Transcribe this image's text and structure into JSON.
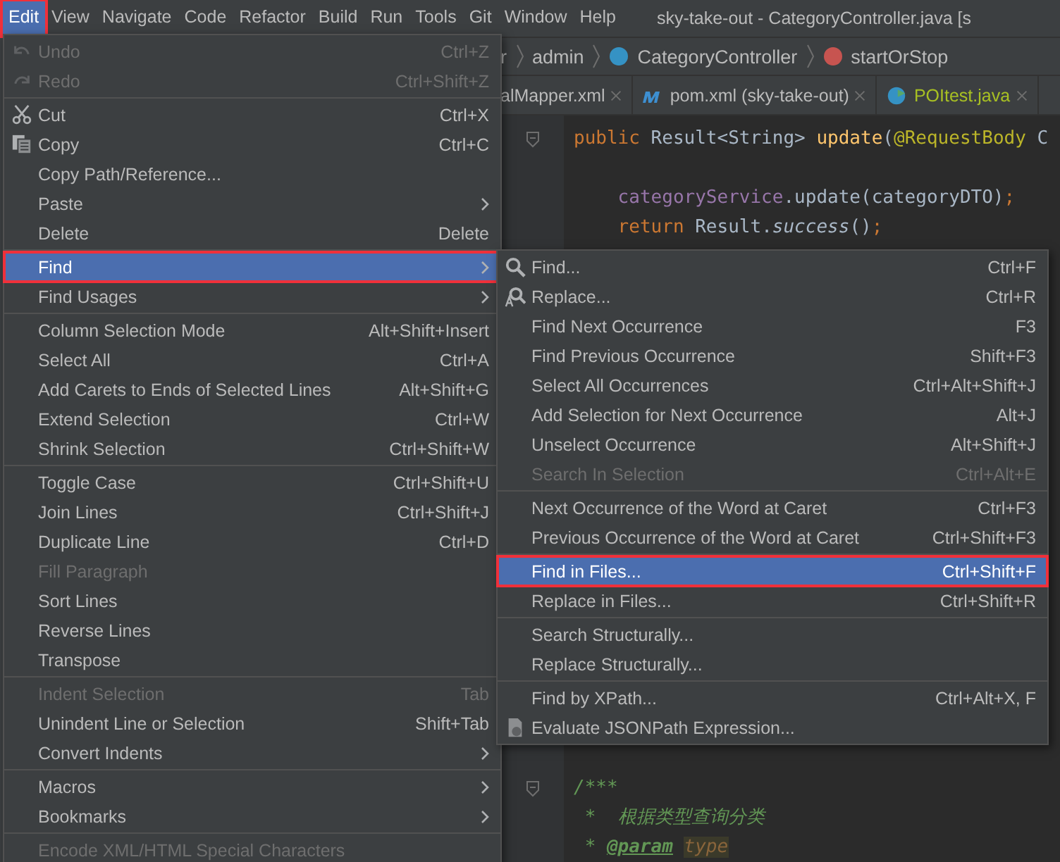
{
  "menu_bar": {
    "items": [
      {
        "label": "Edit",
        "selected": true,
        "highlighted": true
      },
      {
        "label": "View",
        "selected": false,
        "highlighted": false
      },
      {
        "label": "Navigate",
        "selected": false,
        "highlighted": false
      },
      {
        "label": "Code",
        "selected": false,
        "highlighted": false
      },
      {
        "label": "Refactor",
        "selected": false,
        "highlighted": false
      },
      {
        "label": "Build",
        "selected": false,
        "highlighted": false
      },
      {
        "label": "Run",
        "selected": false,
        "highlighted": false
      },
      {
        "label": "Tools",
        "selected": false,
        "highlighted": false
      },
      {
        "label": "Git",
        "selected": false,
        "highlighted": false
      },
      {
        "label": "Window",
        "selected": false,
        "highlighted": false
      },
      {
        "label": "Help",
        "selected": false,
        "highlighted": false
      }
    ],
    "title": "sky-take-out - CategoryController.java [s"
  },
  "breadcrumbs": [
    {
      "label": "r",
      "kind": "text"
    },
    {
      "label": "admin",
      "kind": "text"
    },
    {
      "label": "CategoryController",
      "kind": "class"
    },
    {
      "label": "startOrStop",
      "kind": "method"
    }
  ],
  "tabs": [
    {
      "label": "alMapper.xml",
      "kind": "xml"
    },
    {
      "label": "pom.xml (sky-take-out)",
      "kind": "maven"
    },
    {
      "label": "POItest.java",
      "kind": "test"
    }
  ],
  "code_top": [
    {
      "kind": "code",
      "tokens": [
        {
          "text": "public",
          "kind": "keyword"
        },
        {
          "text": " Result<String> ",
          "kind": "plain"
        },
        {
          "text": "update",
          "kind": "method"
        },
        {
          "text": "(",
          "kind": "plain"
        },
        {
          "text": "@RequestBody",
          "kind": "annotation"
        },
        {
          "text": " C",
          "kind": "plain"
        }
      ]
    },
    {
      "kind": "blank"
    },
    {
      "kind": "code",
      "tokens": [
        {
          "text": "    categoryService",
          "kind": "field"
        },
        {
          "text": ".update(categoryDTO)",
          "kind": "plain"
        },
        {
          "text": ";",
          "kind": "keyword"
        }
      ]
    },
    {
      "kind": "code",
      "tokens": [
        {
          "text": "    return",
          "kind": "keyword"
        },
        {
          "text": " Result.",
          "kind": "plain"
        },
        {
          "text": "success",
          "kind": "static"
        },
        {
          "text": "()",
          "kind": "plain"
        },
        {
          "text": ";",
          "kind": "keyword"
        }
      ]
    }
  ],
  "code_bottom": [
    {
      "kind": "code",
      "tokens": [
        {
          "text": "/***",
          "kind": "comment"
        }
      ]
    },
    {
      "kind": "code",
      "tokens": [
        {
          "text": " *  根据类型查询分类",
          "kind": "comment"
        }
      ]
    },
    {
      "kind": "code",
      "tokens": [
        {
          "text": " * ",
          "kind": "comment"
        },
        {
          "text": "@param",
          "kind": "doctag"
        },
        {
          "text": "type",
          "kind": "docparam"
        }
      ]
    }
  ],
  "edit_menu": {
    "groups": [
      [
        {
          "label": "Undo",
          "shortcut": "Ctrl+Z",
          "kind": "action",
          "disabled": true,
          "selected": false,
          "highlighted": false
        },
        {
          "label": "Redo",
          "shortcut": "Ctrl+Shift+Z",
          "kind": "action",
          "disabled": true,
          "selected": false,
          "highlighted": false
        }
      ],
      [
        {
          "label": "Cut",
          "shortcut": "Ctrl+X",
          "kind": "action",
          "disabled": false,
          "selected": false,
          "highlighted": false
        },
        {
          "label": "Copy",
          "shortcut": "Ctrl+C",
          "kind": "action",
          "disabled": false,
          "selected": false,
          "highlighted": false
        },
        {
          "label": "Copy Path/Reference...",
          "kind": "action",
          "disabled": false,
          "selected": false,
          "highlighted": false
        },
        {
          "label": "Paste",
          "kind": "submenu",
          "disabled": false,
          "selected": false,
          "highlighted": false
        },
        {
          "label": "Delete",
          "shortcut": "Delete",
          "kind": "action",
          "disabled": false,
          "selected": false,
          "highlighted": false
        }
      ],
      [
        {
          "label": "Find",
          "kind": "submenu",
          "disabled": false,
          "selected": true,
          "highlighted": true
        },
        {
          "label": "Find Usages",
          "kind": "submenu",
          "disabled": false,
          "selected": false,
          "highlighted": false
        }
      ],
      [
        {
          "label": "Column Selection Mode",
          "shortcut": "Alt+Shift+Insert",
          "kind": "action",
          "disabled": false,
          "selected": false,
          "highlighted": false
        },
        {
          "label": "Select All",
          "shortcut": "Ctrl+A",
          "kind": "action",
          "disabled": false,
          "selected": false,
          "highlighted": false
        },
        {
          "label": "Add Carets to Ends of Selected Lines",
          "shortcut": "Alt+Shift+G",
          "kind": "action",
          "disabled": false,
          "selected": false,
          "highlighted": false
        },
        {
          "label": "Extend Selection",
          "shortcut": "Ctrl+W",
          "kind": "action",
          "disabled": false,
          "selected": false,
          "highlighted": false
        },
        {
          "label": "Shrink Selection",
          "shortcut": "Ctrl+Shift+W",
          "kind": "action",
          "disabled": false,
          "selected": false,
          "highlighted": false
        }
      ],
      [
        {
          "label": "Toggle Case",
          "shortcut": "Ctrl+Shift+U",
          "kind": "action",
          "disabled": false,
          "selected": false,
          "highlighted": false
        },
        {
          "label": "Join Lines",
          "shortcut": "Ctrl+Shift+J",
          "kind": "action",
          "disabled": false,
          "selected": false,
          "highlighted": false
        },
        {
          "label": "Duplicate Line",
          "shortcut": "Ctrl+D",
          "kind": "action",
          "disabled": false,
          "selected": false,
          "highlighted": false
        },
        {
          "label": "Fill Paragraph",
          "kind": "action",
          "disabled": true,
          "selected": false,
          "highlighted": false
        },
        {
          "label": "Sort Lines",
          "kind": "action",
          "disabled": false,
          "selected": false,
          "highlighted": false
        },
        {
          "label": "Reverse Lines",
          "kind": "action",
          "disabled": false,
          "selected": false,
          "highlighted": false
        },
        {
          "label": "Transpose",
          "kind": "action",
          "disabled": false,
          "selected": false,
          "highlighted": false
        }
      ],
      [
        {
          "label": "Indent Selection",
          "shortcut": "Tab",
          "kind": "action",
          "disabled": true,
          "selected": false,
          "highlighted": false
        },
        {
          "label": "Unindent Line or Selection",
          "shortcut": "Shift+Tab",
          "kind": "action",
          "disabled": false,
          "selected": false,
          "highlighted": false
        },
        {
          "label": "Convert Indents",
          "kind": "submenu",
          "disabled": false,
          "selected": false,
          "highlighted": false
        }
      ],
      [
        {
          "label": "Macros",
          "kind": "submenu",
          "disabled": false,
          "selected": false,
          "highlighted": false
        },
        {
          "label": "Bookmarks",
          "kind": "submenu",
          "disabled": false,
          "selected": false,
          "highlighted": false
        }
      ],
      [
        {
          "label": "Encode XML/HTML Special Characters",
          "kind": "action",
          "disabled": true,
          "selected": false,
          "highlighted": false
        }
      ]
    ]
  },
  "find_menu": {
    "groups": [
      [
        {
          "label": "Find...",
          "shortcut": "Ctrl+F",
          "kind": "action",
          "disabled": false,
          "selected": false,
          "highlighted": false
        },
        {
          "label": "Replace...",
          "shortcut": "Ctrl+R",
          "kind": "action",
          "disabled": false,
          "selected": false,
          "highlighted": false
        },
        {
          "label": "Find Next Occurrence",
          "shortcut": "F3",
          "kind": "action",
          "disabled": false,
          "selected": false,
          "highlighted": false
        },
        {
          "label": "Find Previous Occurrence",
          "shortcut": "Shift+F3",
          "kind": "action",
          "disabled": false,
          "selected": false,
          "highlighted": false
        },
        {
          "label": "Select All Occurrences",
          "shortcut": "Ctrl+Alt+Shift+J",
          "kind": "action",
          "disabled": false,
          "selected": false,
          "highlighted": false
        },
        {
          "label": "Add Selection for Next Occurrence",
          "shortcut": "Alt+J",
          "kind": "action",
          "disabled": false,
          "selected": false,
          "highlighted": false
        },
        {
          "label": "Unselect Occurrence",
          "shortcut": "Alt+Shift+J",
          "kind": "action",
          "disabled": false,
          "selected": false,
          "highlighted": false
        },
        {
          "label": "Search In Selection",
          "shortcut": "Ctrl+Alt+E",
          "kind": "action",
          "disabled": true,
          "selected": false,
          "highlighted": false
        }
      ],
      [
        {
          "label": "Next Occurrence of the Word at Caret",
          "shortcut": "Ctrl+F3",
          "kind": "action",
          "disabled": false,
          "selected": false,
          "highlighted": false
        },
        {
          "label": "Previous Occurrence of the Word at Caret",
          "shortcut": "Ctrl+Shift+F3",
          "kind": "action",
          "disabled": false,
          "selected": false,
          "highlighted": false
        }
      ],
      [
        {
          "label": "Find in Files...",
          "shortcut": "Ctrl+Shift+F",
          "kind": "action",
          "disabled": false,
          "selected": true,
          "highlighted": true
        },
        {
          "label": "Replace in Files...",
          "shortcut": "Ctrl+Shift+R",
          "kind": "action",
          "disabled": false,
          "selected": false,
          "highlighted": false
        }
      ],
      [
        {
          "label": "Search Structurally...",
          "kind": "action",
          "disabled": false,
          "selected": false,
          "highlighted": false
        },
        {
          "label": "Replace Structurally...",
          "kind": "action",
          "disabled": false,
          "selected": false,
          "highlighted": false
        }
      ],
      [
        {
          "label": "Find by XPath...",
          "shortcut": "Ctrl+Alt+X, F",
          "kind": "action",
          "disabled": false,
          "selected": false,
          "highlighted": false
        },
        {
          "label": "Evaluate JSONPath Expression...",
          "kind": "action",
          "disabled": false,
          "selected": false,
          "highlighted": false
        }
      ]
    ]
  }
}
